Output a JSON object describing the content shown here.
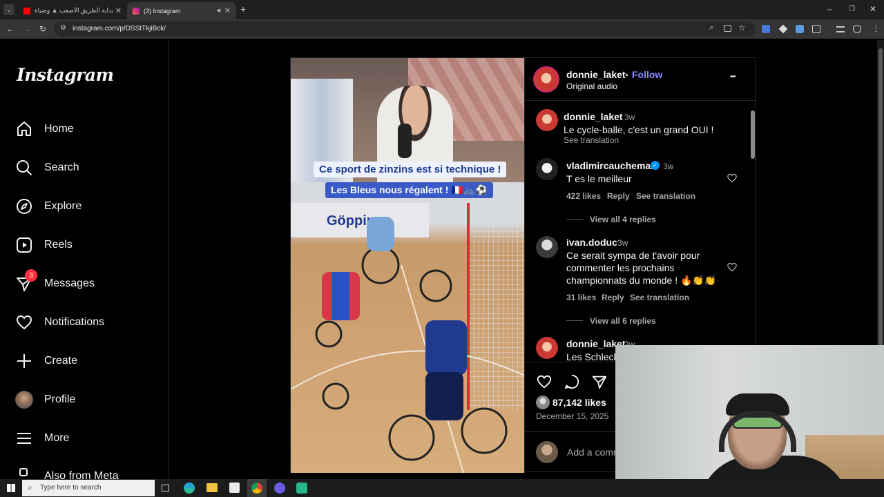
{
  "browser": {
    "tabs": [
      {
        "label": "بداية الطريق الأصعب ▲ وضياة",
        "active": false,
        "favicon_color": "#ff0000"
      },
      {
        "label": "(3) Instagram",
        "active": true,
        "favicon_color": "#d6249f"
      }
    ],
    "new_tab": "+",
    "url": "instagram.com/p/DSStTkjiBck/"
  },
  "sidebar": {
    "logo": "Instagram",
    "items": [
      {
        "label": "Home",
        "icon": "home-icon"
      },
      {
        "label": "Search",
        "icon": "search-icon"
      },
      {
        "label": "Explore",
        "icon": "compass-icon"
      },
      {
        "label": "Reels",
        "icon": "reels-icon"
      },
      {
        "label": "Messages",
        "icon": "messages-icon",
        "badge": "3"
      },
      {
        "label": "Notifications",
        "icon": "heart-icon"
      },
      {
        "label": "Create",
        "icon": "plus-icon"
      },
      {
        "label": "Profile",
        "icon": "profile-avatar"
      },
      {
        "label": "More",
        "icon": "menu-icon"
      },
      {
        "label": "Also from Meta",
        "icon": "meta-icon"
      }
    ]
  },
  "post": {
    "header": {
      "username": "donnie_laket",
      "separator": "•",
      "follow": "Follow",
      "audio": "Original audio",
      "more": "•••"
    },
    "video_captions": {
      "line1": "Ce sport de zinzins est si technique !",
      "line2": "Les Bleus nous régalent ! 🇫🇷🚲⚽",
      "sign": "Göppin"
    },
    "caption": {
      "username": "donnie_laket",
      "time": "3w",
      "text": "Le cycle-balle, c'est un grand OUI !",
      "translate": "See translation"
    },
    "comments": [
      {
        "username": "vladimircauchemar",
        "verified": true,
        "time": "3w",
        "text": "T es le meilleur",
        "likes": "422 likes",
        "reply": "Reply",
        "translate": "See translation",
        "replies": "View all 4 replies"
      },
      {
        "username": "ivan.doduc",
        "verified": false,
        "time": "3w",
        "text": "Ce serait sympa de t'avoir pour commenter les prochains championnats du monde ! 🔥👏👏",
        "likes": "31 likes",
        "reply": "Reply",
        "translate": "See translation",
        "replies": "View all 6 replies"
      },
      {
        "username": "donnie_laket",
        "verified": false,
        "time": "3w",
        "text": "Les Schleck,"
      }
    ],
    "likes": "87,142 likes",
    "date": "December 15, 2025",
    "add_comment_placeholder": "Add a comm"
  },
  "taskbar": {
    "search_placeholder": "Type here to search"
  },
  "colors": {
    "accent": "#0095f6",
    "follow": "#858bff",
    "badge": "#ff3040",
    "background": "#000000"
  }
}
